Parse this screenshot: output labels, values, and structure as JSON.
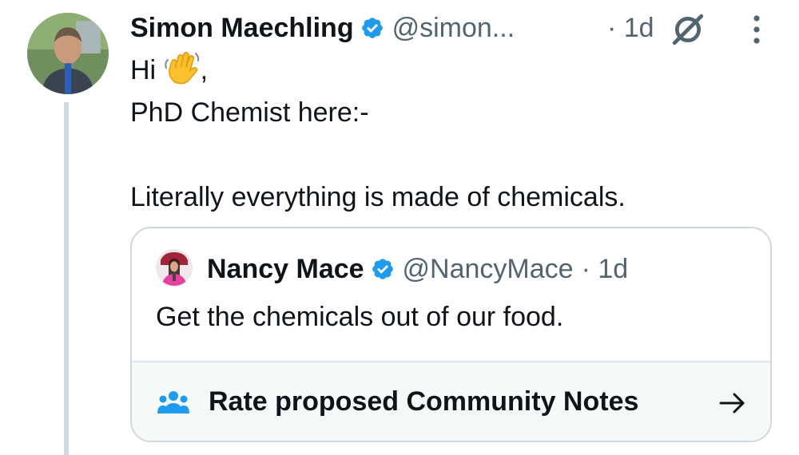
{
  "tweet": {
    "author": {
      "display_name": "Simon Maechling",
      "handle": "@simon...",
      "verified": true
    },
    "time": "· 1d",
    "icons": {
      "verified": "verified-badge-icon",
      "grok": "grok-icon",
      "more": "more-options-icon",
      "wave": "waving-hand-emoji"
    },
    "text_lines": [
      {
        "text": "Hi",
        "suffix": ",",
        "emoji": "waving-hand"
      },
      {
        "text": "PhD Chemist here:-"
      },
      {
        "text": ""
      },
      {
        "text": "Literally everything is made of chemicals."
      }
    ]
  },
  "quote": {
    "author": {
      "display_name": "Nancy Mace",
      "handle": "@NancyMace",
      "verified": true
    },
    "time": "· 1d",
    "text": "Get the chemicals out of our food."
  },
  "community_notes": {
    "label": "Rate proposed Community Notes",
    "icon": "people-icon",
    "arrow_icon": "right-arrow-icon"
  },
  "colors": {
    "text": "#0f1419",
    "secondary": "#536471",
    "verified": "#1d9bf0",
    "community_icon": "#1d9bf0",
    "border": "#cfd9de",
    "thread_line": "#cfd9de"
  }
}
